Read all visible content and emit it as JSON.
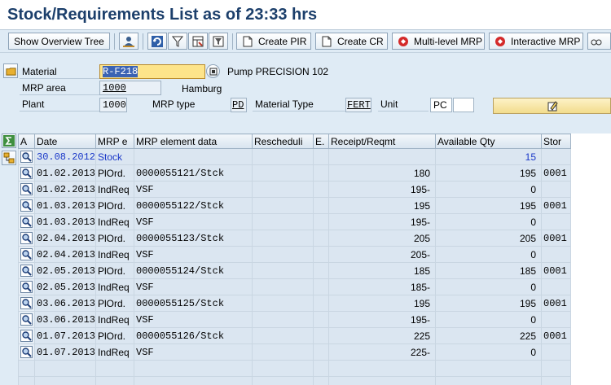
{
  "window": {
    "title": "Stock/Requirements List as of 23:33 hrs"
  },
  "toolbar": {
    "show_overview_tree": "Show Overview Tree",
    "create_pir": "Create PIR",
    "create_cr": "Create CR",
    "multi_level_mrp": "Multi-level MRP",
    "interactive_mrp": "Interactive MRP"
  },
  "header": {
    "material_label": "Material",
    "material_value": "R-F218",
    "material_desc": "Pump PRECISION 102",
    "mrp_area_label": "MRP area",
    "mrp_area_value": "1000",
    "mrp_area_desc": "Hamburg",
    "plant_label": "Plant",
    "plant_value": "1000",
    "mrp_type_label": "MRP type",
    "mrp_type_value": "PD",
    "material_type_label": "Material Type",
    "material_type_value": "FERT",
    "unit_label": "Unit",
    "unit_value": "PC"
  },
  "grid": {
    "columns": [
      "A",
      "Date",
      "MRP e",
      "MRP element data",
      "Rescheduli",
      "E.",
      "Receipt/Reqmt",
      "Available Qty",
      "Stor"
    ],
    "rows": [
      {
        "date": "30.08.2012",
        "mrp_element": "Stock",
        "element_data": "",
        "reschedule": "",
        "e": "",
        "receipt": "",
        "available": "15",
        "stor": ""
      },
      {
        "date": "01.02.2013",
        "mrp_element": "PlOrd.",
        "element_data": "0000055121/Stck",
        "reschedule": "",
        "e": "",
        "receipt": "180",
        "available": "195",
        "stor": "0001"
      },
      {
        "date": "01.02.2013",
        "mrp_element": "IndReq",
        "element_data": "VSF",
        "reschedule": "",
        "e": "",
        "receipt": "195-",
        "available": "0",
        "stor": ""
      },
      {
        "date": "01.03.2013",
        "mrp_element": "PlOrd.",
        "element_data": "0000055122/Stck",
        "reschedule": "",
        "e": "",
        "receipt": "195",
        "available": "195",
        "stor": "0001"
      },
      {
        "date": "01.03.2013",
        "mrp_element": "IndReq",
        "element_data": "VSF",
        "reschedule": "",
        "e": "",
        "receipt": "195-",
        "available": "0",
        "stor": ""
      },
      {
        "date": "02.04.2013",
        "mrp_element": "PlOrd.",
        "element_data": "0000055123/Stck",
        "reschedule": "",
        "e": "",
        "receipt": "205",
        "available": "205",
        "stor": "0001"
      },
      {
        "date": "02.04.2013",
        "mrp_element": "IndReq",
        "element_data": "VSF",
        "reschedule": "",
        "e": "",
        "receipt": "205-",
        "available": "0",
        "stor": ""
      },
      {
        "date": "02.05.2013",
        "mrp_element": "PlOrd.",
        "element_data": "0000055124/Stck",
        "reschedule": "",
        "e": "",
        "receipt": "185",
        "available": "185",
        "stor": "0001"
      },
      {
        "date": "02.05.2013",
        "mrp_element": "IndReq",
        "element_data": "VSF",
        "reschedule": "",
        "e": "",
        "receipt": "185-",
        "available": "0",
        "stor": ""
      },
      {
        "date": "03.06.2013",
        "mrp_element": "PlOrd.",
        "element_data": "0000055125/Stck",
        "reschedule": "",
        "e": "",
        "receipt": "195",
        "available": "195",
        "stor": "0001"
      },
      {
        "date": "03.06.2013",
        "mrp_element": "IndReq",
        "element_data": "VSF",
        "reschedule": "",
        "e": "",
        "receipt": "195-",
        "available": "0",
        "stor": ""
      },
      {
        "date": "01.07.2013",
        "mrp_element": "PlOrd.",
        "element_data": "0000055126/Stck",
        "reschedule": "",
        "e": "",
        "receipt": "225",
        "available": "225",
        "stor": "0001"
      },
      {
        "date": "01.07.2013",
        "mrp_element": "IndReq",
        "element_data": "VSF",
        "reschedule": "",
        "e": "",
        "receipt": "225-",
        "available": "0",
        "stor": ""
      }
    ]
  },
  "colors": {
    "title": "#1c3f6b",
    "stock_row_text": "#1a38c8",
    "cell_bg": "#dbe6f1",
    "selected_input": "#fde48a"
  }
}
